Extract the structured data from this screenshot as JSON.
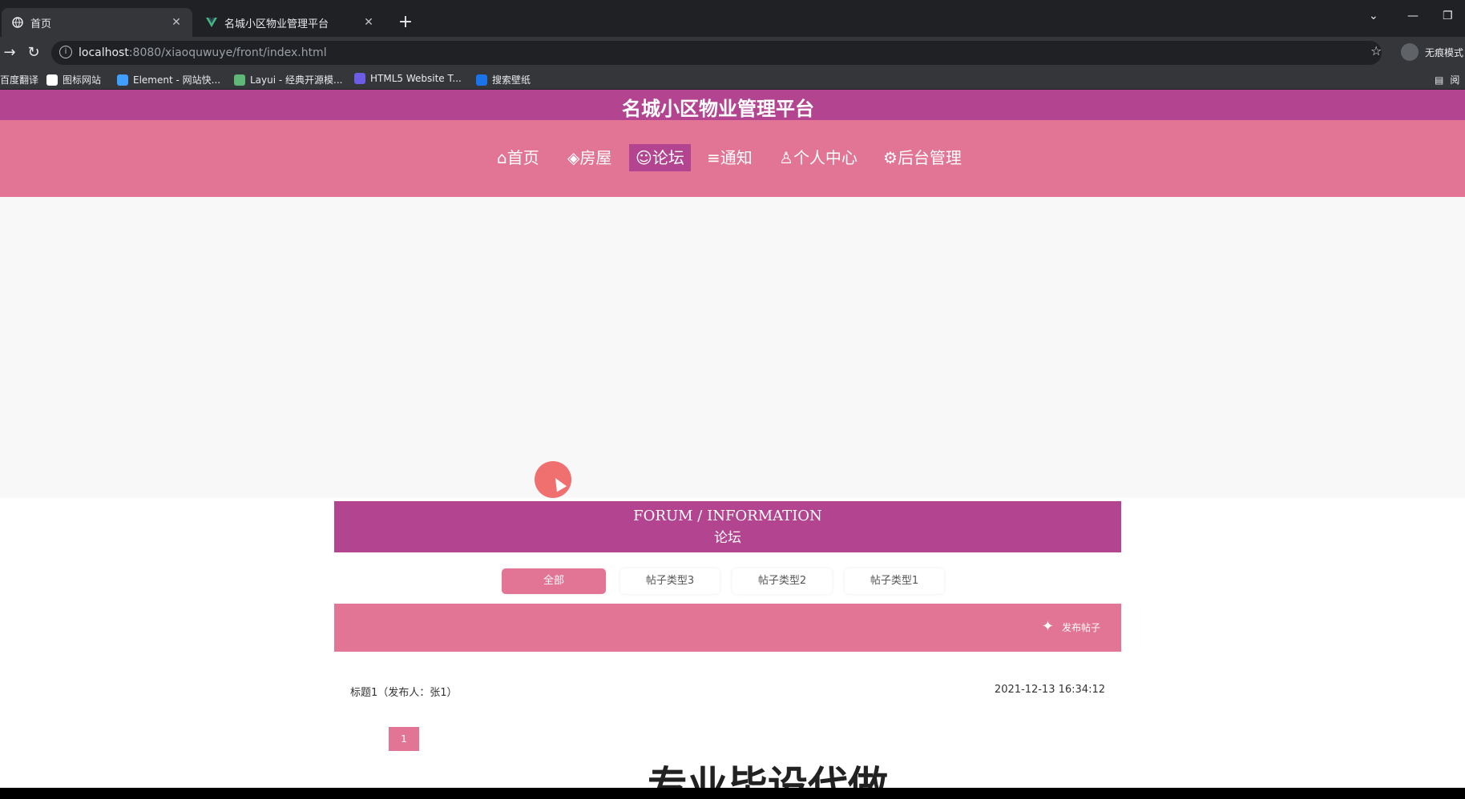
{
  "browser": {
    "tabs": [
      {
        "title": "首页",
        "active": true
      },
      {
        "title": "名城小区物业管理平台",
        "active": false
      }
    ],
    "new_tab": "+",
    "url_host": "localhost",
    "url_rest": ":8080/xiaoquwuye/front/index.html",
    "profile_label": "无痕模式",
    "bookmarks": [
      "百度翻译",
      "图标网站",
      "Element - 网站快...",
      "Layui - 经典开源模...",
      "HTML5 Website T...",
      "搜索壁纸"
    ],
    "reading_list": "阅"
  },
  "site": {
    "title": "名城小区物业管理平台",
    "nav": [
      {
        "icon": "⌂",
        "label": "首页",
        "active": false
      },
      {
        "icon": "◈",
        "label": "房屋",
        "active": false
      },
      {
        "icon": "☺",
        "label": "论坛",
        "active": true
      },
      {
        "icon": "≡",
        "label": "通知",
        "active": false
      },
      {
        "icon": "♙",
        "label": "个人中心",
        "active": false
      },
      {
        "icon": "⚙",
        "label": "后台管理",
        "active": false
      }
    ]
  },
  "forum": {
    "header_en": "FORUM / INFORMATION",
    "header_zh": "论坛",
    "filters": [
      {
        "label": "全部",
        "active": true
      },
      {
        "label": "帖子类型3",
        "active": false
      },
      {
        "label": "帖子类型2",
        "active": false
      },
      {
        "label": "帖子类型1",
        "active": false
      }
    ],
    "publish_label": "发布帖子",
    "posts": [
      {
        "title": "标题1（发布人：张1）",
        "time": "2021-12-13 16:34:12"
      }
    ],
    "page_number": "1"
  },
  "watermark": "专业毕设代做",
  "colors": {
    "primary": "#b3448f",
    "secondary": "#e27495"
  }
}
